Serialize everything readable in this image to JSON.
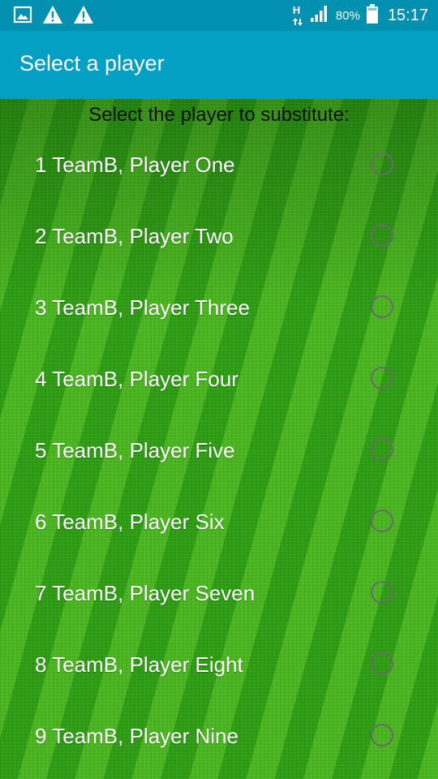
{
  "status_bar": {
    "icons_left": [
      "image-icon",
      "warning-icon",
      "warning-icon"
    ],
    "network_type": "H",
    "battery_percent": "80%",
    "time": "15:17"
  },
  "app_bar": {
    "title": "Select a player"
  },
  "prompt": "Select the player to substitute:",
  "players": [
    {
      "label": "1 TeamB, Player One",
      "selected": false
    },
    {
      "label": "2 TeamB, Player Two",
      "selected": false
    },
    {
      "label": "3 TeamB, Player Three",
      "selected": false
    },
    {
      "label": "4 TeamB, Player Four",
      "selected": false
    },
    {
      "label": "5 TeamB, Player Five",
      "selected": false
    },
    {
      "label": "6 TeamB, Player Six",
      "selected": false
    },
    {
      "label": "7 TeamB, Player Seven",
      "selected": false
    },
    {
      "label": "8 TeamB, Player Eight",
      "selected": false
    },
    {
      "label": "9 TeamB, Player Nine",
      "selected": false
    }
  ],
  "colors": {
    "status_bar_bg": "#0290b0",
    "app_bar_bg": "#03a0c4",
    "radio_border": "#6b6b6b",
    "grass": "#2e9f15"
  }
}
